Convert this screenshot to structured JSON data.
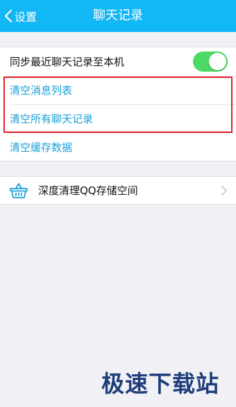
{
  "header": {
    "back_label": "设置",
    "title": "聊天记录"
  },
  "settings": {
    "sync_label": "同步最近聊天记录至本机",
    "sync_enabled": true,
    "clear_message_list": "清空消息列表",
    "clear_all_chat_history": "清空所有聊天记录",
    "clear_cache": "清空缓存数据"
  },
  "deep_clean": {
    "label": "深度清理QQ存储空间",
    "icon": "basket-icon"
  },
  "watermark": "极速下载站",
  "colors": {
    "header": "#12b7f5",
    "link": "#1aa0d8",
    "toggle_on": "#4cd964",
    "highlight": "#e1202a"
  }
}
